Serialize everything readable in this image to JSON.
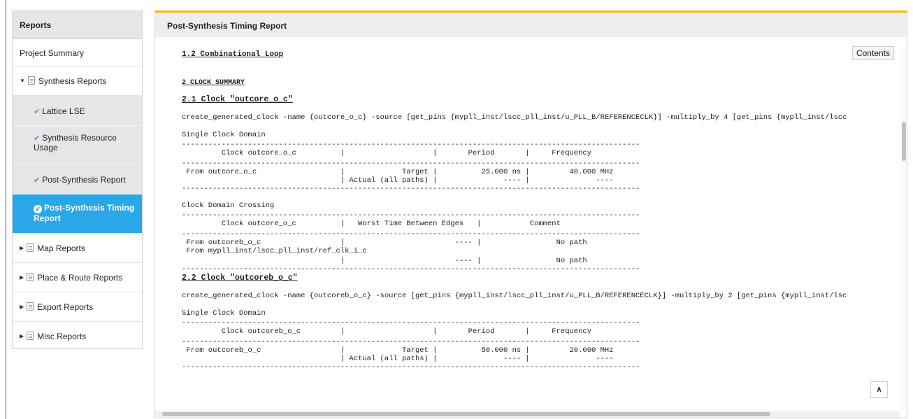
{
  "sidebar": {
    "header": "Reports",
    "project_summary": "Project Summary",
    "synthesis_group": "Synthesis Reports",
    "sub_items": [
      {
        "label": "Lattice LSE"
      },
      {
        "label": "Synthesis Resource Usage"
      },
      {
        "label": "Post-Synthesis Report"
      },
      {
        "label": "Post-Synthesis Timing Report"
      }
    ],
    "groups": [
      {
        "label": "Map Reports"
      },
      {
        "label": "Place & Route Reports"
      },
      {
        "label": "Export Reports"
      },
      {
        "label": "Misc Reports"
      }
    ]
  },
  "main": {
    "title": "Post-Synthesis Timing Report",
    "contents_button": "Contents",
    "up_button": "∧"
  },
  "report": {
    "sec_1_2": "1.2  Combinational Loop",
    "sec_2": "2  CLOCK SUMMARY",
    "sec_2_1": "2.1 Clock \"outcore_o_c\"",
    "cmd_2_1": "create_generated_clock -name {outcore_o_c} -source [get_pins {mypll_inst/lscc_pll_inst/u_PLL_B/REFERENCECLK}] -multiply_by 4 [get_pins {mypll_inst/lscc",
    "scd_1": "Single Clock Domain",
    "dash": "--------------------------------------------------------------------------------------------------------",
    "scd_1_hdr": "         Clock outcore_o_c          |                    |       Period       |     Frequency",
    "scd_1_r1": " From outcore_o_c                   |             Target |          25.000 ns |         40.000 MHz",
    "scd_1_r2": "                                    | Actual (all paths) |               ---- |               ----",
    "cdc": "Clock Domain Crossing",
    "cdc_hdr": "         Clock outcore_o_c          |   Worst Time Between Edges   |           Comment",
    "cdc_r1": " From outcoreb_o_c                  |                         ---- |                 No path",
    "cdc_r2": " From mypll_inst/lscc_pll_inst/ref_clk_i_c",
    "cdc_r3": "                                    |                         ---- |                 No path",
    "sec_2_2": "2.2 Clock \"outcoreb_o_c\"",
    "cmd_2_2": "create_generated_clock -name {outcoreb_o_c} -source [get_pins {mypll_inst/lscc_pll_inst/u_PLL_B/REFERENCECLK}] -multiply_by 2 [get_pins {mypll_inst/lsc",
    "scd_2": "Single Clock Domain",
    "scd_2_hdr": "         Clock outcoreb_o_c         |                    |       Period       |     Frequency",
    "scd_2_r1": " From outcoreb_o_c                  |             Target |          50.000 ns |         20.000 MHz",
    "scd_2_r2": "                                    | Actual (all paths) |               ---- |               ----"
  }
}
